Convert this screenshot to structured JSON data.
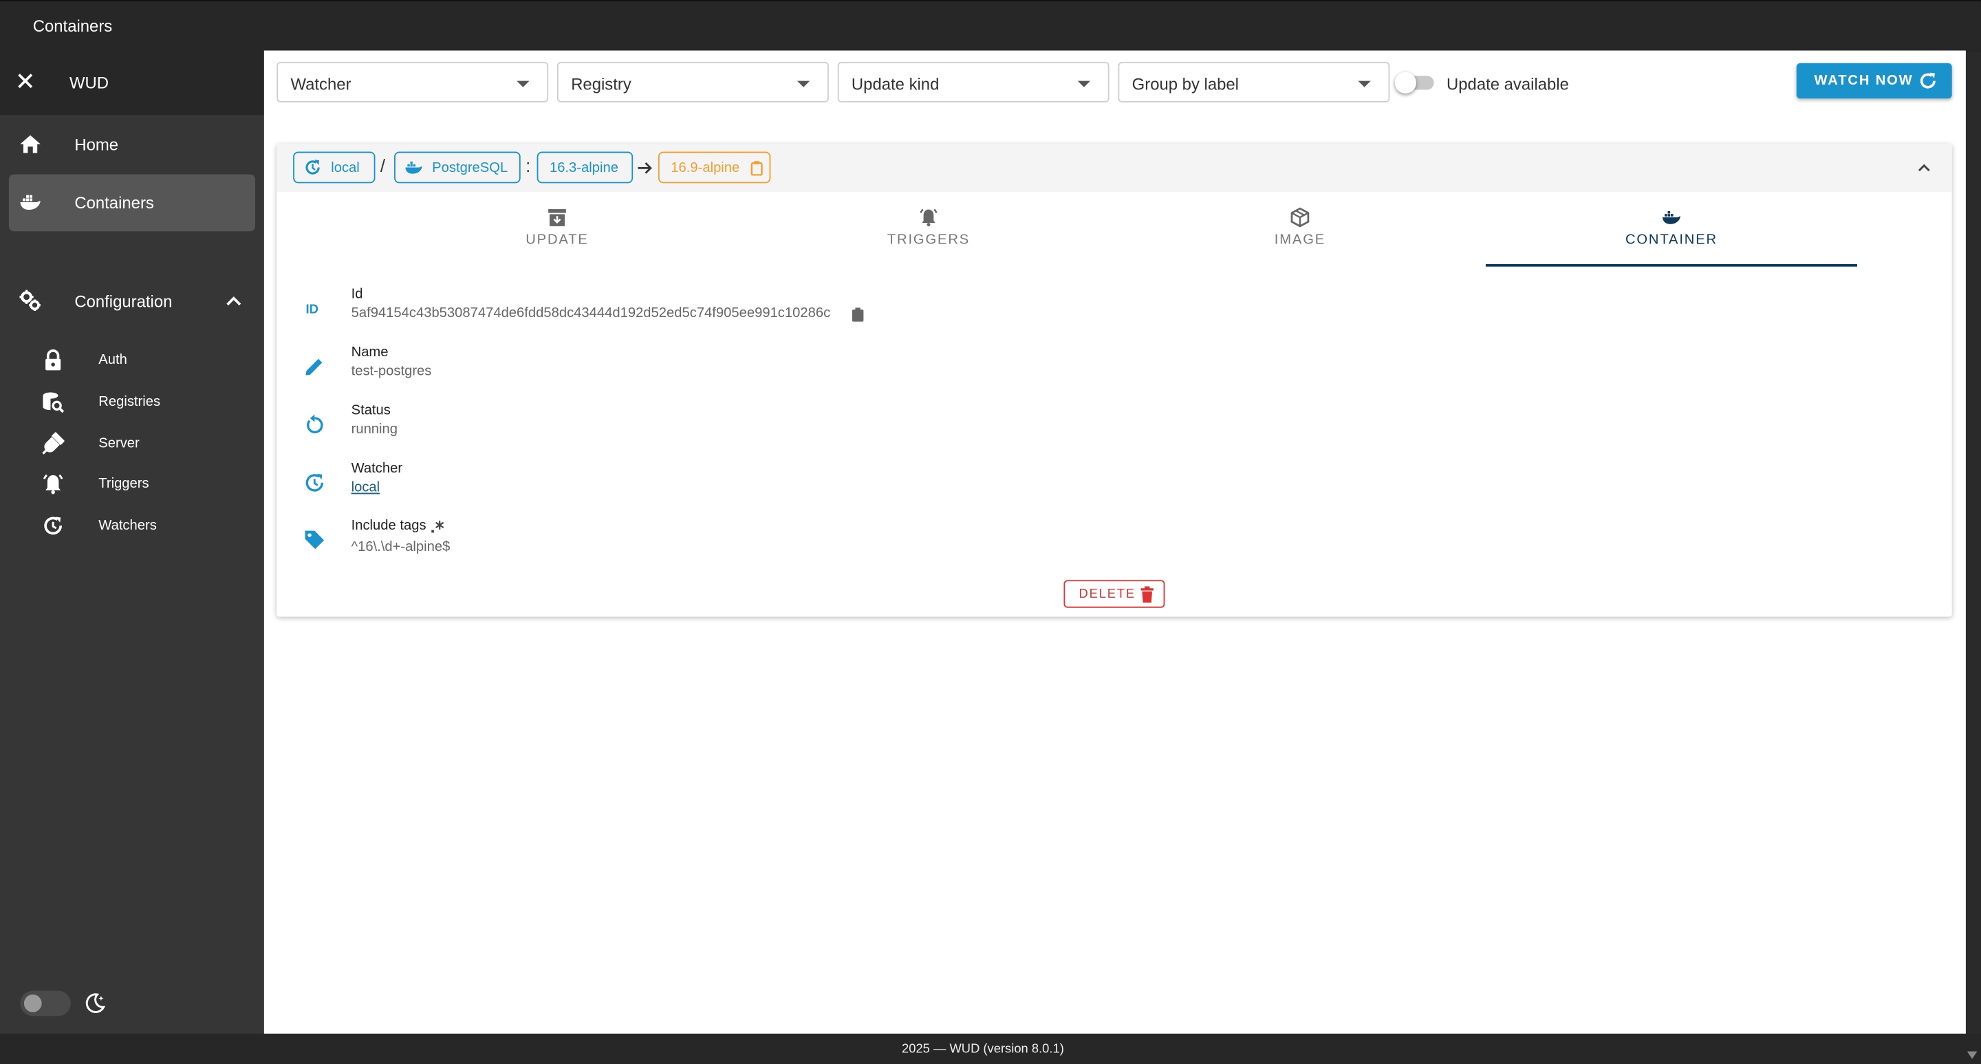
{
  "appbar": {
    "title": "Containers"
  },
  "sidebar": {
    "app_name": "WUD",
    "items": [
      {
        "label": "Home",
        "icon": "home-icon"
      },
      {
        "label": "Containers",
        "icon": "docker-icon"
      }
    ],
    "config_group": {
      "label": "Configuration",
      "icon": "cogs-icon",
      "items": [
        {
          "label": "Auth",
          "icon": "lock-icon"
        },
        {
          "label": "Registries",
          "icon": "database-search-icon"
        },
        {
          "label": "Server",
          "icon": "plug-icon"
        },
        {
          "label": "Triggers",
          "icon": "bell-ring-icon"
        },
        {
          "label": "Watchers",
          "icon": "update-icon"
        }
      ]
    }
  },
  "filters": {
    "watcher": "Watcher",
    "registry": "Registry",
    "update_kind": "Update kind",
    "group_by": "Group by label",
    "update_available": "Update available",
    "update_available_on": false
  },
  "watch_now_label": "WATCH NOW",
  "container": {
    "watcher": "local",
    "registry": "PostgreSQL",
    "separator1": "/",
    "separator2": ":",
    "current_tag": "16.3-alpine",
    "new_tag": "16.9-alpine",
    "tabs": [
      {
        "label": "UPDATE",
        "icon": "archive-arrow-down-icon"
      },
      {
        "label": "TRIGGERS",
        "icon": "bell-ring-icon"
      },
      {
        "label": "IMAGE",
        "icon": "package-icon"
      },
      {
        "label": "CONTAINER",
        "icon": "docker-icon"
      }
    ],
    "active_tab": "CONTAINER",
    "details": {
      "id_label": "Id",
      "id_value": "5af94154c43b53087474de6fdd58dc43444d192d52ed5c74f905ee991c10286c",
      "name_label": "Name",
      "name_value": "test-postgres",
      "status_label": "Status",
      "status_value": "running",
      "watcher_label": "Watcher",
      "watcher_value": "local",
      "tags_label": "Include tags",
      "tags_value": "^16\\.\\d+-alpine$"
    },
    "delete_label": "DELETE"
  },
  "footer": {
    "text": "2025 — WUD (version 8.0.1)"
  },
  "colors": {
    "accent": "#1a92cc",
    "warning": "#f0a030",
    "danger": "#dd3333",
    "tab_active": "#0d3a5c"
  }
}
